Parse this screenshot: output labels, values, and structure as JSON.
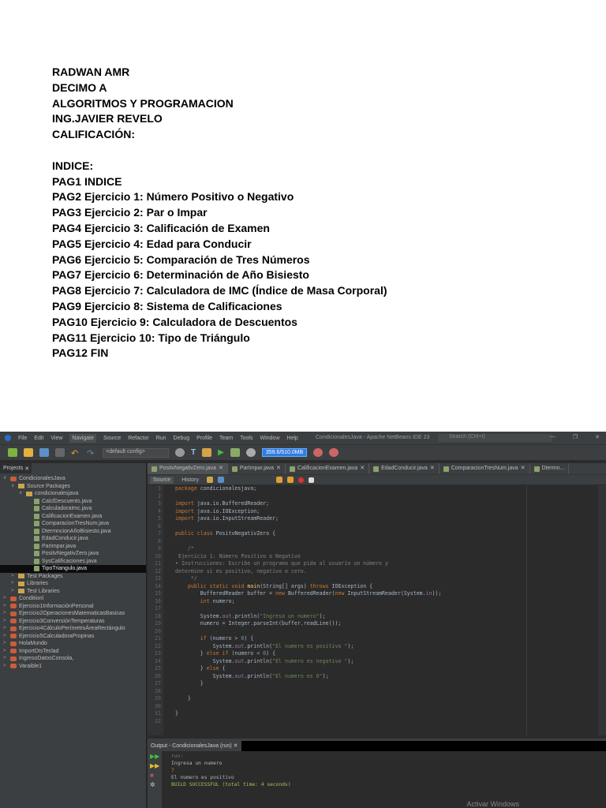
{
  "document": {
    "lines": [
      "RADWAN AMR",
      "DECIMO A",
      "ALGORITMOS Y PROGRAMACION",
      "ING.JAVIER REVELO",
      "CALIFICACIÓN:",
      "",
      "INDICE:",
      "PAG1 INDICE",
      "PAG2 Ejercicio 1: Número Positivo o Negativo",
      "PAG3 Ejercicio 2: Par o Impar",
      "PAG4 Ejercicio 3: Calificación de Examen",
      "PAG5 Ejercicio 4: Edad para Conducir",
      "PAG6 Ejercicio 5: Comparación de Tres Números",
      "PAG7 Ejercicio 6: Determinación de Año Bisiesto",
      "PAG8 Ejercicio 7: Calculadora de IMC (Índice de Masa Corporal)",
      "PAG9 Ejercicio 8: Sistema de Calificaciones",
      "PAG10 Ejercicio 9: Calculadora de Descuentos",
      "PAG11 Ejercicio 10: Tipo de Triángulo",
      "PAG12 FIN"
    ]
  },
  "ide": {
    "title": "CondicionalesJava - Apache NetBeans IDE 23",
    "menu": [
      "File",
      "Edit",
      "View",
      "Navigate",
      "Source",
      "Refactor",
      "Run",
      "Debug",
      "Profile",
      "Team",
      "Tools",
      "Window",
      "Help"
    ],
    "search_placeholder": "Search (Ctrl+I)",
    "config": "<default config>",
    "memory": "359.6/510.0MB",
    "projects_tab": "Projects",
    "tree": [
      {
        "label": "CondicionalesJava",
        "depth": 0,
        "type": "project",
        "open": true
      },
      {
        "label": "Source Packages",
        "depth": 1,
        "type": "folder",
        "open": true
      },
      {
        "label": "condicionalesjava",
        "depth": 2,
        "type": "package",
        "open": true
      },
      {
        "label": "CalclDescuents.java",
        "depth": 3,
        "type": "file"
      },
      {
        "label": "CalculadoraImc.java",
        "depth": 3,
        "type": "file"
      },
      {
        "label": "CalificacionExamen.java",
        "depth": 3,
        "type": "file"
      },
      {
        "label": "ComparacionTresNum.java",
        "depth": 3,
        "type": "file"
      },
      {
        "label": "DtermncionAñoBisiesto.java",
        "depth": 3,
        "type": "file"
      },
      {
        "label": "EdadConducir.java",
        "depth": 3,
        "type": "file"
      },
      {
        "label": "ParImpar.java",
        "depth": 3,
        "type": "file"
      },
      {
        "label": "PositvNegativZero.java",
        "depth": 3,
        "type": "file"
      },
      {
        "label": "SysCalificaciones.java",
        "depth": 3,
        "type": "file"
      },
      {
        "label": "TipoTriangulo.java",
        "depth": 3,
        "type": "file",
        "selected": true
      },
      {
        "label": "Test Packages",
        "depth": 1,
        "type": "folder"
      },
      {
        "label": "Libraries",
        "depth": 1,
        "type": "folder"
      },
      {
        "label": "Test Libraries",
        "depth": 1,
        "type": "folder"
      },
      {
        "label": "Conditionl",
        "depth": 0,
        "type": "project"
      },
      {
        "label": "Ejercicio1InformaciónPersonal",
        "depth": 0,
        "type": "project"
      },
      {
        "label": "Ejercicio2OperacionesMatematicasBasicas",
        "depth": 0,
        "type": "project"
      },
      {
        "label": "Ejercicio3ConversiónTemperaturas",
        "depth": 0,
        "type": "project"
      },
      {
        "label": "Ejercicio4CálculoPerímetroÁreaRectángulo",
        "depth": 0,
        "type": "project"
      },
      {
        "label": "Ejercicio5CalculadoraPropinas",
        "depth": 0,
        "type": "project"
      },
      {
        "label": "HolaMundo",
        "depth": 0,
        "type": "project"
      },
      {
        "label": "ImportDtsTeclad",
        "depth": 0,
        "type": "project"
      },
      {
        "label": "IngresoDatosConsola,",
        "depth": 0,
        "type": "project"
      },
      {
        "label": "Varaible1",
        "depth": 0,
        "type": "project"
      }
    ],
    "editor_tabs": [
      "PositvNegativZero.java",
      "ParImpar.java",
      "CalificacionExamen.java",
      "EdadConducir.java",
      "ComparacionTresNum.java",
      "Dtermn..."
    ],
    "source_label": "Source",
    "history_label": "History",
    "code": [
      [
        [
          "kw",
          "package "
        ],
        [
          "pl",
          "condicionalesjava;"
        ]
      ],
      [],
      [
        [
          "kw",
          "import "
        ],
        [
          "pl",
          "java.io.BufferedReader;"
        ]
      ],
      [
        [
          "kw",
          "import "
        ],
        [
          "pl",
          "java.io.IOException;"
        ]
      ],
      [
        [
          "kw",
          "import "
        ],
        [
          "pl",
          "java.io.InputStreamReader;"
        ]
      ],
      [],
      [
        [
          "kw",
          "public class "
        ],
        [
          "pl",
          "PositvNegativZero {"
        ]
      ],
      [],
      [
        [
          "cm",
          "    /*"
        ]
      ],
      [
        [
          "cm",
          " Ejercicio 1: Número Positivo o Negativo"
        ]
      ],
      [
        [
          "cm",
          "• Instrucciones: Escribe un programa que pida al usuario un número y"
        ]
      ],
      [
        [
          "cm",
          "determine si es positivo, negativo o cero."
        ]
      ],
      [
        [
          "cm",
          "     */"
        ]
      ],
      [
        [
          "kw",
          "    public static void "
        ],
        [
          "fn",
          "main"
        ],
        [
          "pl",
          "(String[] args) "
        ],
        [
          "kw",
          "throws "
        ],
        [
          "pl",
          "IOException {"
        ]
      ],
      [
        [
          "pl",
          "        BufferedReader buffer = "
        ],
        [
          "kw",
          "new "
        ],
        [
          "pl",
          "BufferedReader("
        ],
        [
          "kw",
          "new "
        ],
        [
          "pl",
          "InputStreamReader(System."
        ],
        [
          "fld",
          "in"
        ],
        [
          "pl",
          "));"
        ]
      ],
      [
        [
          "kw",
          "        int "
        ],
        [
          "pl",
          "numero;"
        ]
      ],
      [],
      [
        [
          "pl",
          "        System."
        ],
        [
          "fld",
          "out"
        ],
        [
          "pl",
          ".println("
        ],
        [
          "str",
          "\"Ingresa un numero\""
        ],
        [
          "pl",
          ");"
        ]
      ],
      [
        [
          "pl",
          "        numero = Integer.parseInt(buffer.readLine());"
        ]
      ],
      [],
      [
        [
          "kw",
          "        if "
        ],
        [
          "pl",
          "(numero > "
        ],
        [
          "num",
          "0"
        ],
        [
          "pl",
          ") {"
        ]
      ],
      [
        [
          "pl",
          "            System."
        ],
        [
          "fld",
          "out"
        ],
        [
          "pl",
          ".println("
        ],
        [
          "str",
          "\"El numero es positivo \""
        ],
        [
          "pl",
          ");"
        ]
      ],
      [
        [
          "pl",
          "        } "
        ],
        [
          "kw",
          "else if "
        ],
        [
          "pl",
          "(numero < "
        ],
        [
          "num",
          "0"
        ],
        [
          "pl",
          ") {"
        ]
      ],
      [
        [
          "pl",
          "            System."
        ],
        [
          "fld",
          "out"
        ],
        [
          "pl",
          ".println("
        ],
        [
          "str",
          "\"El numero es negativo \""
        ],
        [
          "pl",
          ");"
        ]
      ],
      [
        [
          "pl",
          "        } "
        ],
        [
          "kw",
          "else "
        ],
        [
          "pl",
          "{"
        ]
      ],
      [
        [
          "pl",
          "            System."
        ],
        [
          "fld",
          "out"
        ],
        [
          "pl",
          ".println("
        ],
        [
          "str",
          "\"El numero es 0\""
        ],
        [
          "pl",
          ");"
        ]
      ],
      [
        [
          "pl",
          "        }"
        ]
      ],
      [],
      [
        [
          "pl",
          "    }"
        ]
      ],
      [],
      [
        [
          "pl",
          "}"
        ]
      ],
      []
    ],
    "output_tab": "Output - CondicionalesJava (run)",
    "output": [
      [
        "dim",
        "run:"
      ],
      [
        "pl",
        "Ingresa un numero"
      ],
      [
        "inp",
        "7"
      ],
      [
        "pl",
        "El numero es positivo"
      ],
      [
        "ok",
        "BUILD SUCCESSFUL (total time: 4 seconds)"
      ]
    ],
    "watermark": "Activar Windows"
  }
}
